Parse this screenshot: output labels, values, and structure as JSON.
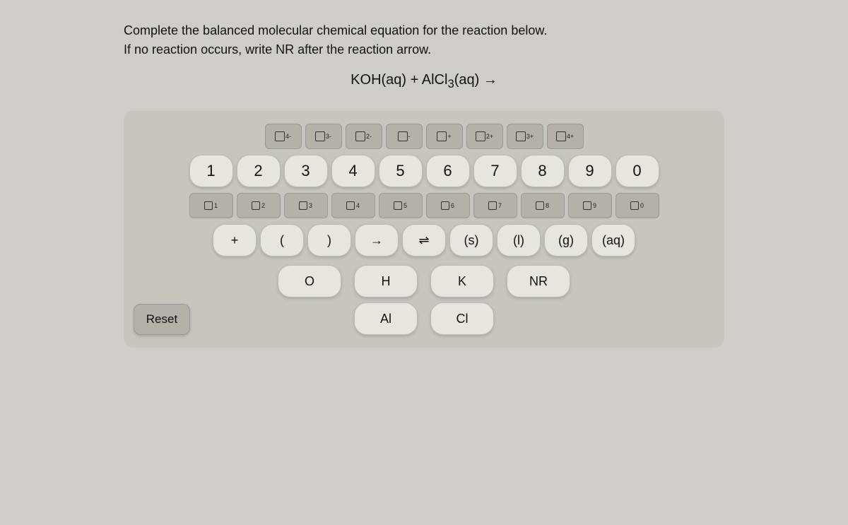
{
  "instructions": {
    "line1": "Complete the balanced molecular chemical equation for the reaction below.",
    "line2": "If no reaction occurs, write NR after the reaction arrow."
  },
  "equation": "KOH(aq) + AlCl₃(aq) →",
  "keyboard": {
    "charge_row": [
      {
        "label": "4-",
        "sup": "4-"
      },
      {
        "label": "3-",
        "sup": "3-"
      },
      {
        "label": "2-",
        "sup": "2-"
      },
      {
        "label": "-",
        "sup": "-"
      },
      {
        "label": "+",
        "sup": "+"
      },
      {
        "label": "2+",
        "sup": "2+"
      },
      {
        "label": "3+",
        "sup": "3+"
      },
      {
        "label": "4+",
        "sup": "4+"
      }
    ],
    "digit_row": [
      "1",
      "2",
      "3",
      "4",
      "5",
      "6",
      "7",
      "8",
      "9",
      "0"
    ],
    "subdigit_row": [
      "1",
      "2",
      "3",
      "4",
      "5",
      "6",
      "7",
      "8",
      "9",
      "0"
    ],
    "symbol_row": [
      {
        "label": "+",
        "type": "plus"
      },
      {
        "label": "(",
        "type": "paren"
      },
      {
        "label": ")",
        "type": "paren"
      },
      {
        "label": "→",
        "type": "arrow"
      },
      {
        "label": "⇌",
        "type": "eq-arrow"
      },
      {
        "label": "(s)",
        "type": "state"
      },
      {
        "label": "(l)",
        "type": "state"
      },
      {
        "label": "(g)",
        "type": "state"
      },
      {
        "label": "(aq)",
        "type": "state"
      }
    ],
    "element_rows": [
      [
        {
          "label": "O",
          "col": 1
        },
        {
          "label": "H",
          "col": 2
        },
        {
          "label": "K",
          "col": 3
        },
        {
          "label": "NR",
          "col": 4
        }
      ],
      [
        {
          "label": "Al",
          "col": 2
        },
        {
          "label": "Cl",
          "col": 3
        }
      ]
    ],
    "reset_label": "Reset"
  }
}
